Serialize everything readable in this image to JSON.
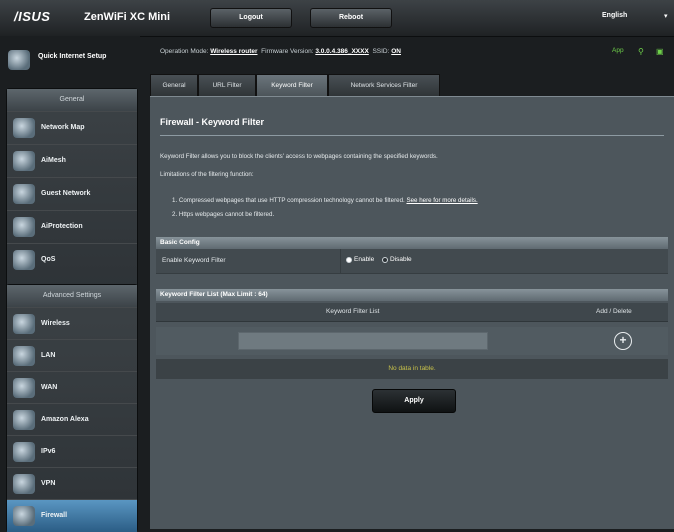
{
  "header": {
    "logo": "/ISUS",
    "product": "ZenWiFi XC Mini",
    "logout_label": "Logout",
    "reboot_label": "Reboot",
    "language": "English"
  },
  "sidebar": {
    "quick_setup_label": "Quick Internet Setup",
    "general_header": "General",
    "general_items": [
      {
        "label": "Network Map",
        "icon": "network-map-icon"
      },
      {
        "label": "AiMesh",
        "icon": "aimesh-icon"
      },
      {
        "label": "Guest Network",
        "icon": "guest-network-icon"
      },
      {
        "label": "AiProtection",
        "icon": "aiprotection-icon"
      },
      {
        "label": "QoS",
        "icon": "qos-icon"
      }
    ],
    "advanced_header": "Advanced Settings",
    "advanced_items": [
      {
        "label": "Wireless",
        "icon": "wireless-icon"
      },
      {
        "label": "LAN",
        "icon": "lan-icon"
      },
      {
        "label": "WAN",
        "icon": "wan-icon"
      },
      {
        "label": "Amazon Alexa",
        "icon": "alexa-icon"
      },
      {
        "label": "IPv6",
        "icon": "ipv6-icon"
      },
      {
        "label": "VPN",
        "icon": "vpn-icon"
      },
      {
        "label": "Firewall",
        "icon": "firewall-icon"
      }
    ]
  },
  "status": {
    "op_mode_label": "Operation Mode:",
    "op_mode_value": "Wireless router",
    "firmware_label": "Firmware Version:",
    "firmware_value": "3.0.0.4.386_XXXX",
    "ssid_label": "SSID:",
    "ssid_value": "ON",
    "app_label": "App"
  },
  "tabs": [
    "General",
    "URL Filter",
    "Keyword Filter",
    "Network Services Filter"
  ],
  "page": {
    "title": "Firewall - Keyword Filter",
    "description": "Keyword Filter allows you to block the clients' access to webpages containing the specified keywords.",
    "limitations_heading": "Limitations of the filtering function:",
    "limitation_1_prefix": "1.  Compressed webpages that use HTTP compression technology cannot be filtered.",
    "limitation_1_link": "See here for more details.",
    "limitation_2": "2.  Https webpages cannot be filtered."
  },
  "basic_config": {
    "header": "Basic Config",
    "enable_label": "Enable Keyword Filter",
    "enable_option": "Enable",
    "disable_option": "Disable",
    "selected": "Enable"
  },
  "keyword_list": {
    "header": "Keyword Filter List (Max Limit : 64)",
    "col_list": "Keyword Filter List",
    "col_action": "Add / Delete",
    "input_value": "",
    "empty_text": "No data in table."
  },
  "apply_label": "Apply"
}
